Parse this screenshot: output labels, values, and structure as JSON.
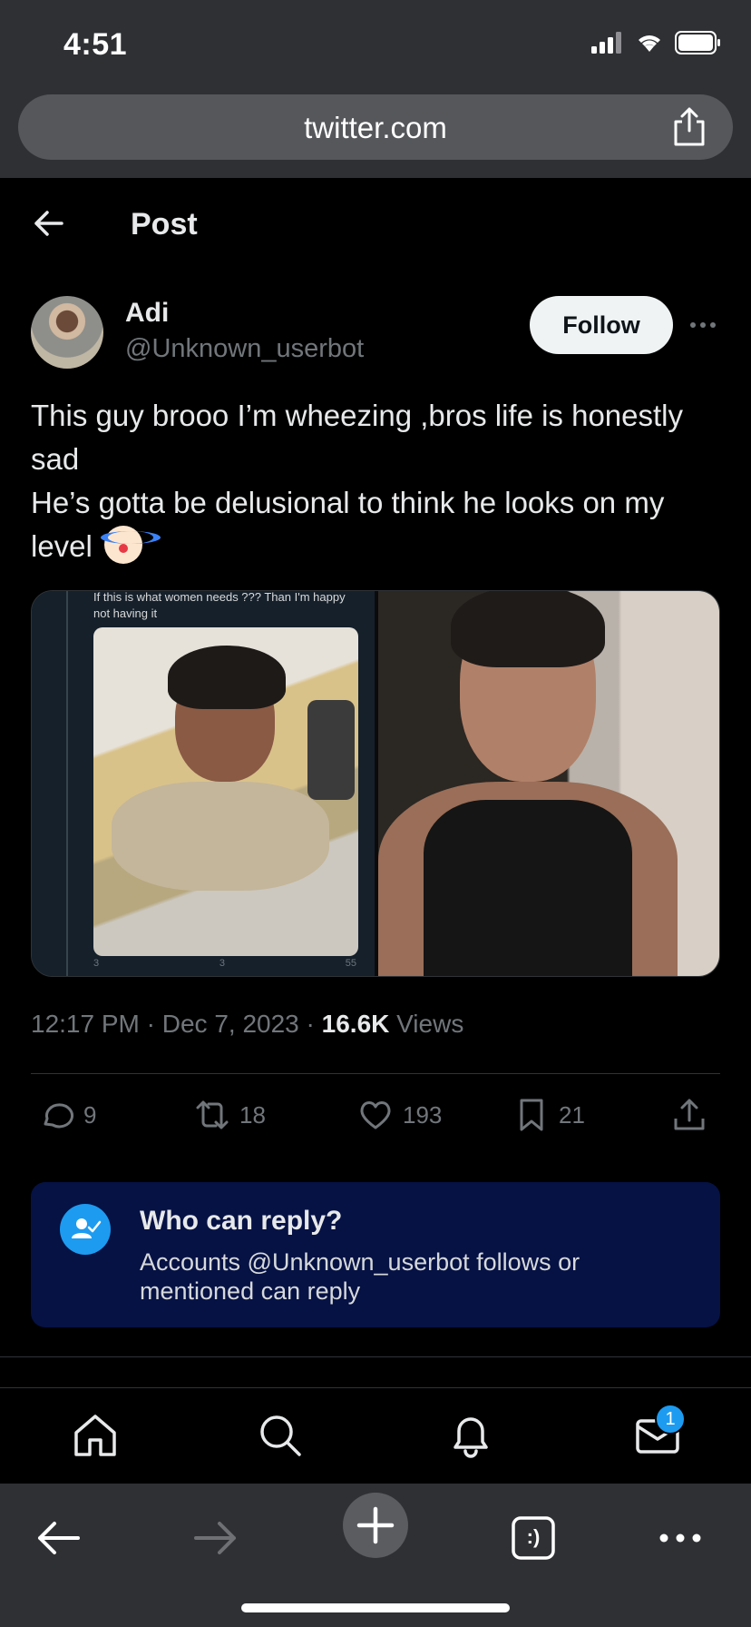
{
  "status_bar": {
    "time": "4:51"
  },
  "browser": {
    "url": "twitter.com"
  },
  "header": {
    "title": "Post"
  },
  "author": {
    "name": "Adi",
    "handle": "@Unknown_userbot"
  },
  "follow_button": {
    "label": "Follow"
  },
  "tweet": {
    "text": "This guy brooo I’m wheezing ,bros life is honestly sad\nHe’s gotta be delusional to think he looks on my level ",
    "emoji": "clown-face",
    "media": {
      "inner_text": "If this is what women needs ??? Than I'm happy not having it",
      "inner_actions": {
        "replies": "3",
        "likes": "3",
        "views": "55"
      }
    }
  },
  "meta": {
    "time": "12:17 PM",
    "date": "Dec 7, 2023",
    "views_count": "16.6K",
    "views_label": "Views",
    "separator": "·"
  },
  "actions": {
    "replies": "9",
    "reposts": "18",
    "likes": "193",
    "bookmarks": "21"
  },
  "reply_restriction": {
    "title": "Who can reply?",
    "description": "Accounts @Unknown_userbot follows or mentioned can reply"
  },
  "tabbar": {
    "items": [
      "home-icon",
      "search-icon",
      "notifications-icon",
      "messages-icon"
    ],
    "messages_badge": "1"
  },
  "browser_toolbar": {
    "items": [
      "back-icon",
      "forward-icon",
      "new-tab-icon",
      "tabs-icon",
      "more-icon"
    ],
    "tabs_glyph": ":)"
  },
  "colors": {
    "accent": "#1d9bf0",
    "background": "#000000",
    "chrome": "#2f3033",
    "reply_box": "#061244",
    "muted": "#71767b"
  }
}
